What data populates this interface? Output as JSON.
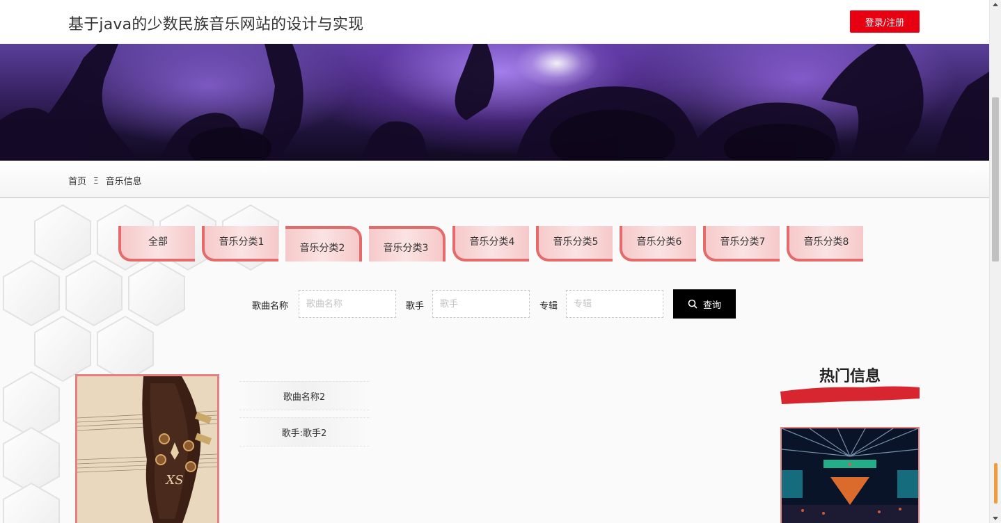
{
  "header": {
    "site_title": "基于java的少数民族音乐网站的设计与实现",
    "login_label": "登录/注册",
    "login_color": "#e60012"
  },
  "breadcrumb": {
    "home": "首页",
    "separator": "Ξ",
    "current": "音乐信息"
  },
  "tabs": [
    "全部",
    "音乐分类1",
    "音乐分类2",
    "音乐分类3",
    "音乐分类4",
    "音乐分类5",
    "音乐分类6",
    "音乐分类7",
    "音乐分类8"
  ],
  "search": {
    "song_label": "歌曲名称",
    "song_placeholder": "歌曲名称",
    "singer_label": "歌手",
    "singer_placeholder": "歌手",
    "album_label": "专辑",
    "album_placeholder": "专辑",
    "button_label": "查询",
    "button_icon": "search-icon"
  },
  "music_list": [
    {
      "name": "歌曲名称2",
      "singer": "歌手:歌手2"
    }
  ],
  "hot": {
    "title": "热门信息",
    "accent_color": "#d7262f"
  },
  "colors": {
    "tab_border": "#e36b6b",
    "tab_fill": "#f8d4d4",
    "search_button": "#000000"
  }
}
